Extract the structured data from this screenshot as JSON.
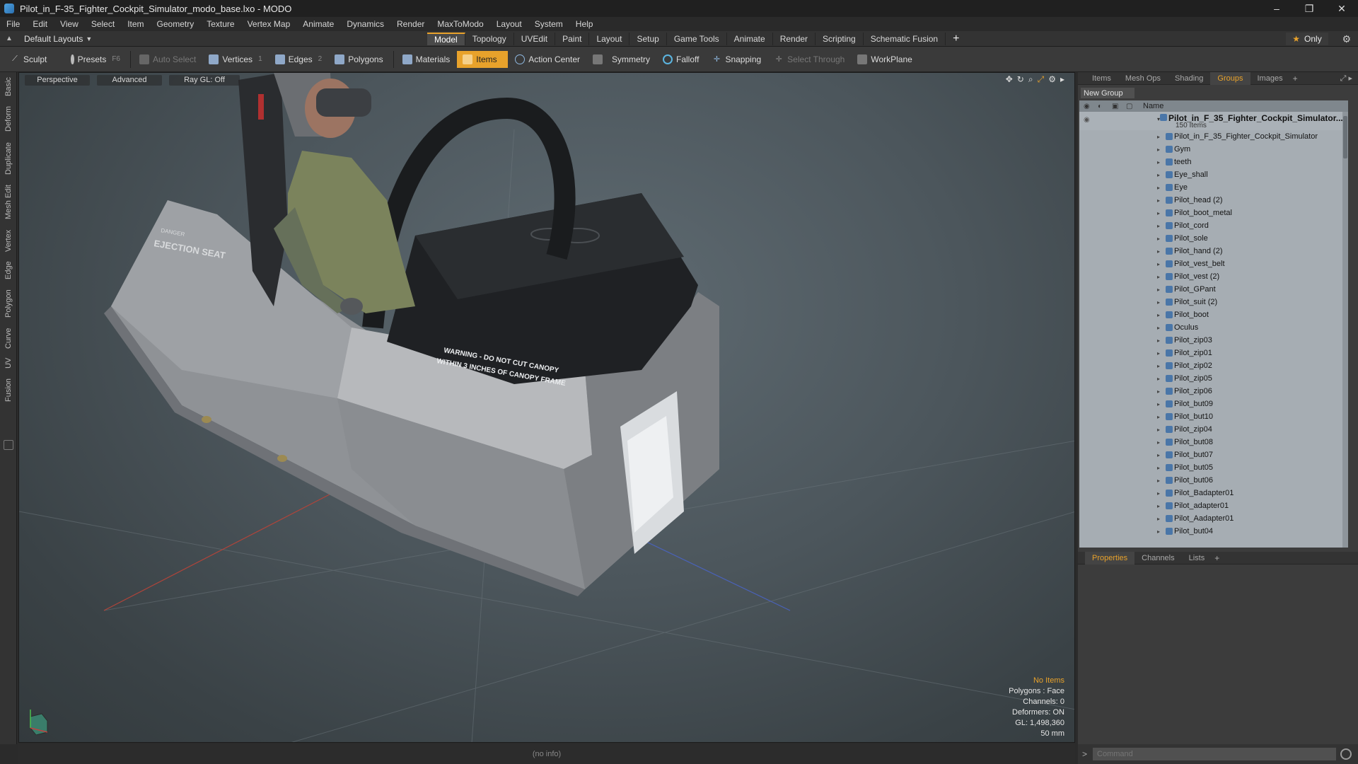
{
  "window": {
    "title": "Pilot_in_F-35_Fighter_Cockpit_Simulator_modo_base.lxo - MODO",
    "controls": [
      "–",
      "❐",
      "✕"
    ]
  },
  "menu": [
    "File",
    "Edit",
    "View",
    "Select",
    "Item",
    "Geometry",
    "Texture",
    "Vertex Map",
    "Animate",
    "Dynamics",
    "Render",
    "MaxToModo",
    "Layout",
    "System",
    "Help"
  ],
  "layout": {
    "current": "Default Layouts",
    "tabs": [
      "Model",
      "Topology",
      "UVEdit",
      "Paint",
      "Layout",
      "Setup",
      "Game Tools",
      "Animate",
      "Render",
      "Scripting",
      "Schematic Fusion"
    ],
    "active_tab": "Model",
    "only_label": "Only"
  },
  "toolbar": {
    "sculpt": "Sculpt",
    "presets": "Presets",
    "presets_key": "F6",
    "auto_select": "Auto Select",
    "vertices": "Vertices",
    "vertices_key": "1",
    "edges": "Edges",
    "edges_key": "2",
    "polygons": "Polygons",
    "materials": "Materials",
    "items": "Items",
    "action_center": "Action Center",
    "symmetry": "Symmetry",
    "falloff": "Falloff",
    "snapping": "Snapping",
    "select_through": "Select Through",
    "workplane": "WorkPlane"
  },
  "left_tabs": [
    "Basic",
    "Deform",
    "Duplicate",
    "Mesh Edit",
    "Vertex",
    "Edge",
    "Polygon",
    "Curve",
    "UV",
    "Fusion"
  ],
  "viewport": {
    "view": "Perspective",
    "shading": "Advanced",
    "raygl": "Ray GL: Off",
    "info": {
      "selection": "No Items",
      "polygons": "Polygons : Face",
      "channels": "Channels: 0",
      "deformers": "Deformers: ON",
      "gl": "GL: 1,498,360",
      "focal": "50 mm"
    },
    "decals": {
      "ejection_seat": "EJECTION SEAT",
      "danger": "DANGER",
      "warning_line1": "WARNING - DO NOT CUT CANOPY",
      "warning_line2": "WITHIN 3 INCHES OF CANOPY FRAME"
    }
  },
  "status": "(no info)",
  "right_panel": {
    "tabs": [
      "Items",
      "Mesh Ops",
      "Shading",
      "Groups",
      "Images"
    ],
    "active_tab": "Groups",
    "new_group": "New Group",
    "column_name": "Name",
    "root": {
      "name": "Pilot_in_F_35_Fighter_Cockpit_Simulator...",
      "count": "150 Items"
    },
    "items": [
      "Pilot_in_F_35_Fighter_Cockpit_Simulator",
      "Gym",
      "teeth",
      "Eye_shall",
      "Eye",
      "Pilot_head (2)",
      "Pilot_boot_metal",
      "Pilot_cord",
      "Pilot_sole",
      "Pilot_hand (2)",
      "Pilot_vest_belt",
      "Pilot_vest (2)",
      "Pilot_GPant",
      "Pilot_suit (2)",
      "Pilot_boot",
      "Oculus",
      "Pilot_zip03",
      "Pilot_zip01",
      "Pilot_zip02",
      "Pilot_zip05",
      "Pilot_zip06",
      "Pilot_but09",
      "Pilot_but10",
      "Pilot_zip04",
      "Pilot_but08",
      "Pilot_but07",
      "Pilot_but05",
      "Pilot_but06",
      "Pilot_Badapter01",
      "Pilot_adapter01",
      "Pilot_Aadapter01",
      "Pilot_but04"
    ],
    "bottom_tabs": [
      "Properties",
      "Channels",
      "Lists"
    ],
    "bottom_active": "Properties",
    "command_placeholder": "Command"
  }
}
